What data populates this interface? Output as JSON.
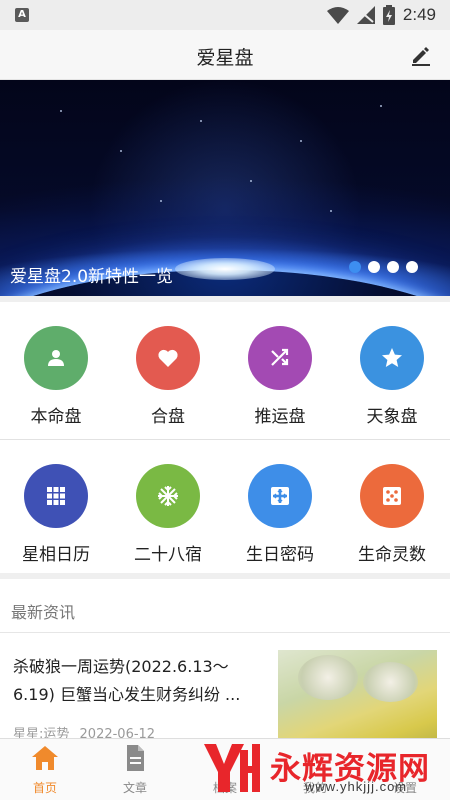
{
  "status_bar": {
    "time": "2:49",
    "left_icon": "A"
  },
  "header": {
    "title": "爱星盘",
    "edit_icon": "edit-icon"
  },
  "banner": {
    "caption": "爱星盘2.0新特性一览",
    "slide_count": 4,
    "active_index": 0
  },
  "grid": {
    "row1": [
      {
        "label": "本命盘",
        "icon": "person-icon",
        "color": "#5fad6b"
      },
      {
        "label": "合盘",
        "icon": "heart-icon",
        "color": "#e35a50"
      },
      {
        "label": "推运盘",
        "icon": "shuffle-icon",
        "color": "#a34ab3"
      },
      {
        "label": "天象盘",
        "icon": "star-icon",
        "color": "#3b92e0"
      }
    ],
    "row2": [
      {
        "label": "星相日历",
        "icon": "grid-icon",
        "color": "#3f51b5"
      },
      {
        "label": "二十八宿",
        "icon": "snowflake-icon",
        "color": "#7ab944"
      },
      {
        "label": "生日密码",
        "icon": "cross-box-icon",
        "color": "#3e8ee8"
      },
      {
        "label": "生命灵数",
        "icon": "dice-icon",
        "color": "#ec6a3c"
      }
    ]
  },
  "news": {
    "section_title": "最新资讯",
    "items": [
      {
        "title": "杀破狼一周运势(2022.6.13～6.19) 巨蟹当心发生财务纠纷 ...",
        "source": "星星:运势",
        "date": "2022-06-12"
      }
    ]
  },
  "bottom_nav": {
    "items": [
      {
        "label": "首页",
        "icon": "home-icon",
        "active": true
      },
      {
        "label": "文章",
        "icon": "document-icon",
        "active": false
      },
      {
        "label": "档案",
        "icon": "folder-icon",
        "active": false
      },
      {
        "label": "我的",
        "icon": "user-icon",
        "active": false
      },
      {
        "label": "设置",
        "icon": "settings-icon",
        "active": false
      }
    ]
  },
  "watermark": {
    "text": "永辉资源网",
    "url": "www.yhkjjj.com"
  },
  "colors": {
    "accent": "#f08a2c",
    "dot_active": "#3d8ef0",
    "watermark_red": "#e8262b"
  }
}
